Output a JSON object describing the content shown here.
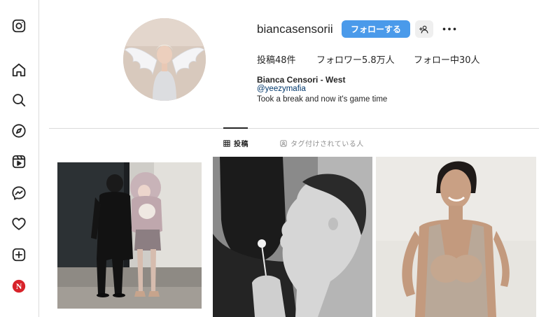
{
  "sidebar": {
    "items": [
      {
        "name": "instagram-icon"
      },
      {
        "name": "home-icon"
      },
      {
        "name": "search-icon"
      },
      {
        "name": "explore-icon"
      },
      {
        "name": "reels-icon"
      },
      {
        "name": "messenger-icon"
      },
      {
        "name": "heart-icon"
      },
      {
        "name": "create-icon"
      },
      {
        "name": "profile-n-icon",
        "letter": "N"
      }
    ]
  },
  "profile": {
    "username": "biancasensorii",
    "follow_label": "フォローする",
    "stats": {
      "posts": "投稿48件",
      "followers": "フォロワー5.8万人",
      "following": "フォロー中30人"
    },
    "full_name": "Bianca Censori - West",
    "link": "@yeezymafia",
    "bio": "Took a break and now it's game time"
  },
  "tabs": {
    "posts_label": "投稿",
    "tagged_label": "タグ付けされている人"
  },
  "colors": {
    "accent": "#4a9aea",
    "link": "#00376b",
    "text": "#262626",
    "muted": "#8e8e8e",
    "border": "#dbdbdb"
  }
}
